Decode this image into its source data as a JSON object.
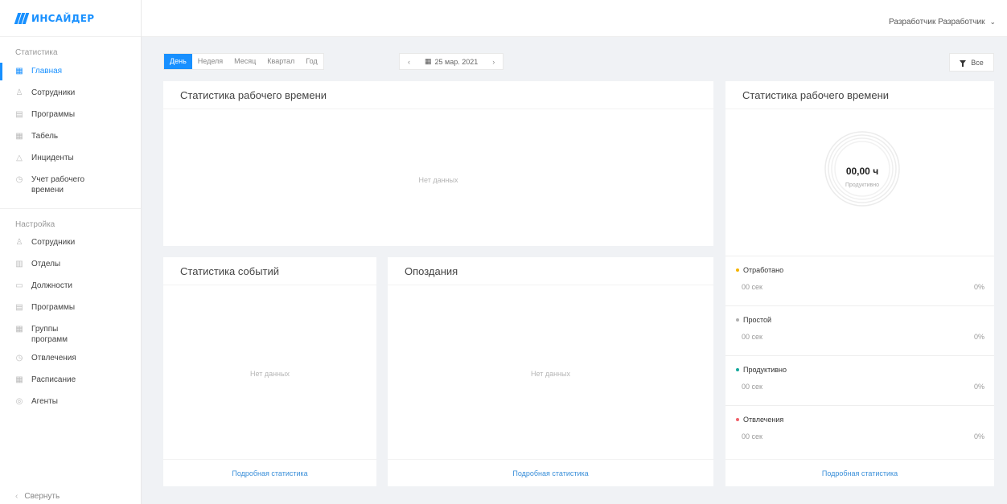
{
  "brand": {
    "name": "ИНСАЙДЕР",
    "color": "#1890ff"
  },
  "header": {
    "user_name": "Разработчик Разработчик"
  },
  "sidebar": {
    "section_stats": "Статистика",
    "stats_items": [
      {
        "label": "Главная",
        "icon": "dashboard-icon"
      },
      {
        "label": "Сотрудники",
        "icon": "user-icon"
      },
      {
        "label": "Программы",
        "icon": "window-icon"
      },
      {
        "label": "Табель",
        "icon": "table-icon"
      },
      {
        "label": "Инциденты",
        "icon": "warning-icon"
      },
      {
        "label": "Учет рабочего времени",
        "icon": "clock-icon"
      }
    ],
    "section_settings": "Настройка",
    "settings_items": [
      {
        "label": "Сотрудники",
        "icon": "user-icon"
      },
      {
        "label": "Отделы",
        "icon": "building-icon"
      },
      {
        "label": "Должности",
        "icon": "id-card-icon"
      },
      {
        "label": "Программы",
        "icon": "window-icon"
      },
      {
        "label": "Группы программ",
        "icon": "grid-icon"
      },
      {
        "label": "Отвлечения",
        "icon": "clock-icon"
      },
      {
        "label": "Расписание",
        "icon": "calendar-icon"
      },
      {
        "label": "Агенты",
        "icon": "agent-icon"
      }
    ],
    "collapse_label": "Свернуть"
  },
  "toolbar": {
    "periods": [
      "День",
      "Неделя",
      "Месяц",
      "Квартал",
      "Год"
    ],
    "active_period": "День",
    "date": "25 мар. 2021",
    "prev": "‹",
    "next": "›",
    "filter_label": "Все"
  },
  "cards": {
    "work_time": {
      "title": "Статистика рабочего времени",
      "empty": "Нет данных"
    },
    "events": {
      "title": "Статистика событий",
      "empty": "Нет данных",
      "link": "Подробная статистика"
    },
    "late": {
      "title": "Опоздания",
      "empty": "Нет данных",
      "link": "Подробная статистика"
    },
    "summary": {
      "title": "Статистика рабочего времени",
      "donut_value": "00,00 ч",
      "donut_label": "Продуктивно",
      "link": "Подробная статистика",
      "legend": [
        {
          "name": "Отработано",
          "time": "00 сек",
          "pct": "0%",
          "color": "#f5b400"
        },
        {
          "name": "Простой",
          "time": "00 сек",
          "pct": "0%",
          "color": "#b0b0b0"
        },
        {
          "name": "Продуктивно",
          "time": "00 сек",
          "pct": "0%",
          "color": "#14a89c"
        },
        {
          "name": "Отвлечения",
          "time": "00 сек",
          "pct": "0%",
          "color": "#f0606a"
        }
      ]
    }
  }
}
